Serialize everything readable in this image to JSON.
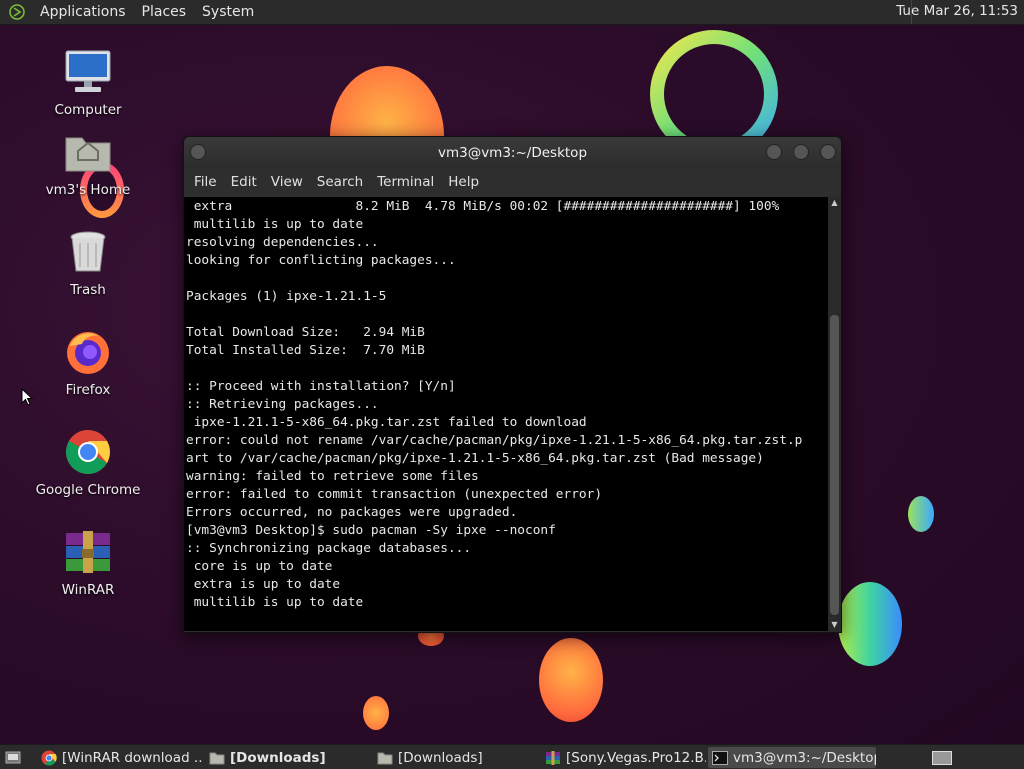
{
  "top_panel": {
    "menus": [
      "Applications",
      "Places",
      "System"
    ],
    "clock": "Tue Mar 26, 11:53"
  },
  "desktop_icons": [
    {
      "label": "Computer",
      "icon": "computer-icon"
    },
    {
      "label": "vm3's Home",
      "icon": "home-folder-icon"
    },
    {
      "label": "Trash",
      "icon": "trash-icon"
    },
    {
      "label": "Firefox",
      "icon": "firefox-icon"
    },
    {
      "label": "Google Chrome",
      "icon": "chrome-icon"
    },
    {
      "label": "WinRAR",
      "icon": "winrar-icon"
    }
  ],
  "terminal": {
    "title": "vm3@vm3:~/Desktop",
    "menus": [
      "File",
      "Edit",
      "View",
      "Search",
      "Terminal",
      "Help"
    ],
    "lines": [
      " extra                8.2 MiB  4.78 MiB/s 00:02 [######################] 100%",
      " multilib is up to date",
      "resolving dependencies...",
      "looking for conflicting packages...",
      "",
      "Packages (1) ipxe-1.21.1-5",
      "",
      "Total Download Size:   2.94 MiB",
      "Total Installed Size:  7.70 MiB",
      "",
      ":: Proceed with installation? [Y/n]",
      ":: Retrieving packages...",
      " ipxe-1.21.1-5-x86_64.pkg.tar.zst failed to download",
      "error: could not rename /var/cache/pacman/pkg/ipxe-1.21.1-5-x86_64.pkg.tar.zst.p",
      "art to /var/cache/pacman/pkg/ipxe-1.21.1-5-x86_64.pkg.tar.zst (Bad message)",
      "warning: failed to retrieve some files",
      "error: failed to commit transaction (unexpected error)",
      "Errors occurred, no packages were upgraded.",
      "[vm3@vm3 Desktop]$ sudo pacman -Sy ipxe --noconf",
      ":: Synchronizing package databases...",
      " core is up to date",
      " extra is up to date",
      " multilib is up to date"
    ]
  },
  "taskbar": {
    "tasks": [
      {
        "label": "[WinRAR download ...",
        "icon": "chrome-icon",
        "active": false
      },
      {
        "label": "[Downloads]",
        "icon": "folder-icon",
        "active": false,
        "bold": true
      },
      {
        "label": "[Downloads]",
        "icon": "folder-icon",
        "active": false
      },
      {
        "label": "[Sony.Vegas.Pro12.B...",
        "icon": "winrar-icon",
        "active": false
      },
      {
        "label": "vm3@vm3:~/Desktop",
        "icon": "terminal-icon",
        "active": true
      }
    ]
  },
  "colors": {
    "desktop_bg": "#2a0b2a",
    "panel_bg": "#2b2b2b",
    "terminal_bg": "#000000",
    "terminal_fg": "#e8e8e8"
  }
}
